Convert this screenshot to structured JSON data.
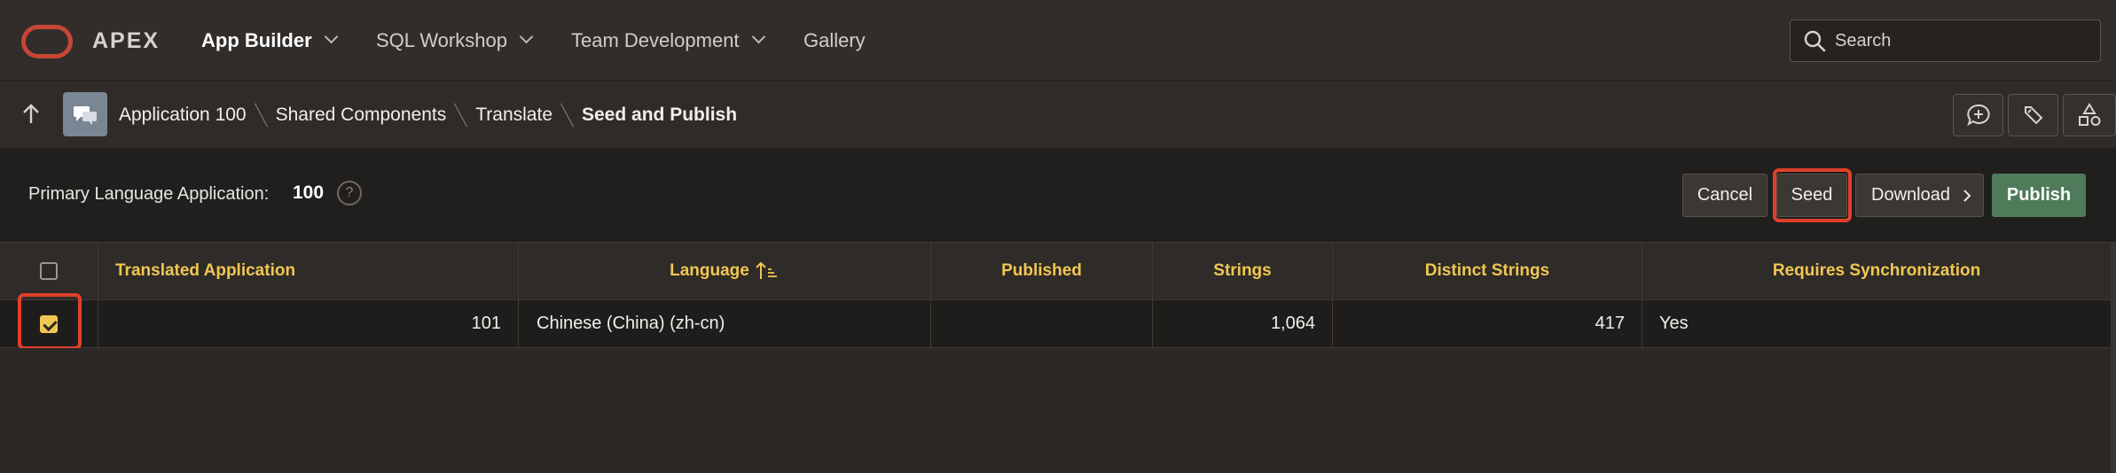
{
  "header": {
    "logo_text": "APEX",
    "nav": [
      {
        "label": "App Builder",
        "active": true,
        "has_menu": true
      },
      {
        "label": "SQL Workshop",
        "active": false,
        "has_menu": true
      },
      {
        "label": "Team Development",
        "active": false,
        "has_menu": true
      },
      {
        "label": "Gallery",
        "active": false,
        "has_menu": false
      }
    ],
    "search_placeholder": "Search"
  },
  "breadcrumb": {
    "items": [
      "Application 100",
      "Shared Components",
      "Translate",
      "Seed and Publish"
    ]
  },
  "region": {
    "primary_language_label": "Primary Language Application:",
    "primary_language_value": "100",
    "help_glyph": "?",
    "buttons": {
      "cancel": "Cancel",
      "seed": "Seed",
      "download": "Download",
      "publish": "Publish"
    }
  },
  "grid": {
    "columns": [
      "Translated Application",
      "Language",
      "Published",
      "Strings",
      "Distinct Strings",
      "Requires Synchronization"
    ],
    "sort_column": "Language",
    "rows": [
      {
        "checked": true,
        "translated_application": "101",
        "language": "Chinese (China) (zh-cn)",
        "published": "",
        "strings": "1,064",
        "distinct_strings": "417",
        "requires_synchronization": "Yes"
      }
    ]
  },
  "colors": {
    "accent_header": "#f0c752",
    "publish_button": "#4f7b5b",
    "highlight": "#e0402b",
    "logo": "#c74634"
  }
}
